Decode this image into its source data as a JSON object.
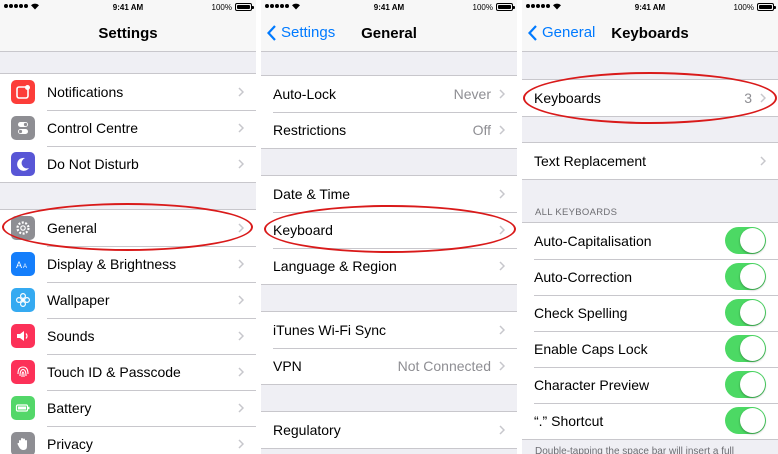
{
  "status_bar": {
    "time": "9:41 AM",
    "battery": "100%"
  },
  "colors": {
    "accent": "#007aff",
    "toggle_on": "#4cd964",
    "annotation": "#d91a1a",
    "icon_notifications": "#fc3d39",
    "icon_control_centre": "#8e8e93",
    "icon_do_not_disturb": "#5856d6",
    "icon_general": "#8e8e93",
    "icon_display": "#147efb",
    "icon_wallpaper": "#35aaf1",
    "icon_sounds": "#fc3158",
    "icon_touch_id": "#fc3158",
    "icon_battery": "#53d769",
    "icon_privacy": "#8e8e93"
  },
  "settings": {
    "title": "Settings",
    "items": [
      {
        "label": "Notifications",
        "icon": "notifications-icon"
      },
      {
        "label": "Control Centre",
        "icon": "control-centre-icon"
      },
      {
        "label": "Do Not Disturb",
        "icon": "moon-icon"
      },
      {
        "label": "General",
        "icon": "gear-icon"
      },
      {
        "label": "Display & Brightness",
        "icon": "display-icon"
      },
      {
        "label": "Wallpaper",
        "icon": "wallpaper-icon"
      },
      {
        "label": "Sounds",
        "icon": "speaker-icon"
      },
      {
        "label": "Touch ID & Passcode",
        "icon": "fingerprint-icon"
      },
      {
        "label": "Battery",
        "icon": "battery-icon"
      },
      {
        "label": "Privacy",
        "icon": "hand-icon"
      }
    ]
  },
  "general": {
    "back": "Settings",
    "title": "General",
    "items": [
      {
        "label": "Auto-Lock",
        "value": "Never"
      },
      {
        "label": "Restrictions",
        "value": "Off"
      },
      {
        "label": "Date & Time"
      },
      {
        "label": "Keyboard"
      },
      {
        "label": "Language & Region"
      },
      {
        "label": "iTunes Wi-Fi Sync"
      },
      {
        "label": "VPN",
        "value": "Not Connected"
      },
      {
        "label": "Regulatory"
      }
    ]
  },
  "keyboards": {
    "back": "General",
    "title": "Keyboards",
    "keyboards_row": {
      "label": "Keyboards",
      "value": "3"
    },
    "text_replacement": "Text Replacement",
    "section_header": "ALL KEYBOARDS",
    "toggles": [
      {
        "label": "Auto-Capitalisation",
        "on": true
      },
      {
        "label": "Auto-Correction",
        "on": true
      },
      {
        "label": "Check Spelling",
        "on": true
      },
      {
        "label": "Enable Caps Lock",
        "on": true
      },
      {
        "label": "Character Preview",
        "on": true
      },
      {
        "label": "“.” Shortcut",
        "on": true
      }
    ],
    "footer": "Double-tapping the space bar will insert a full"
  }
}
